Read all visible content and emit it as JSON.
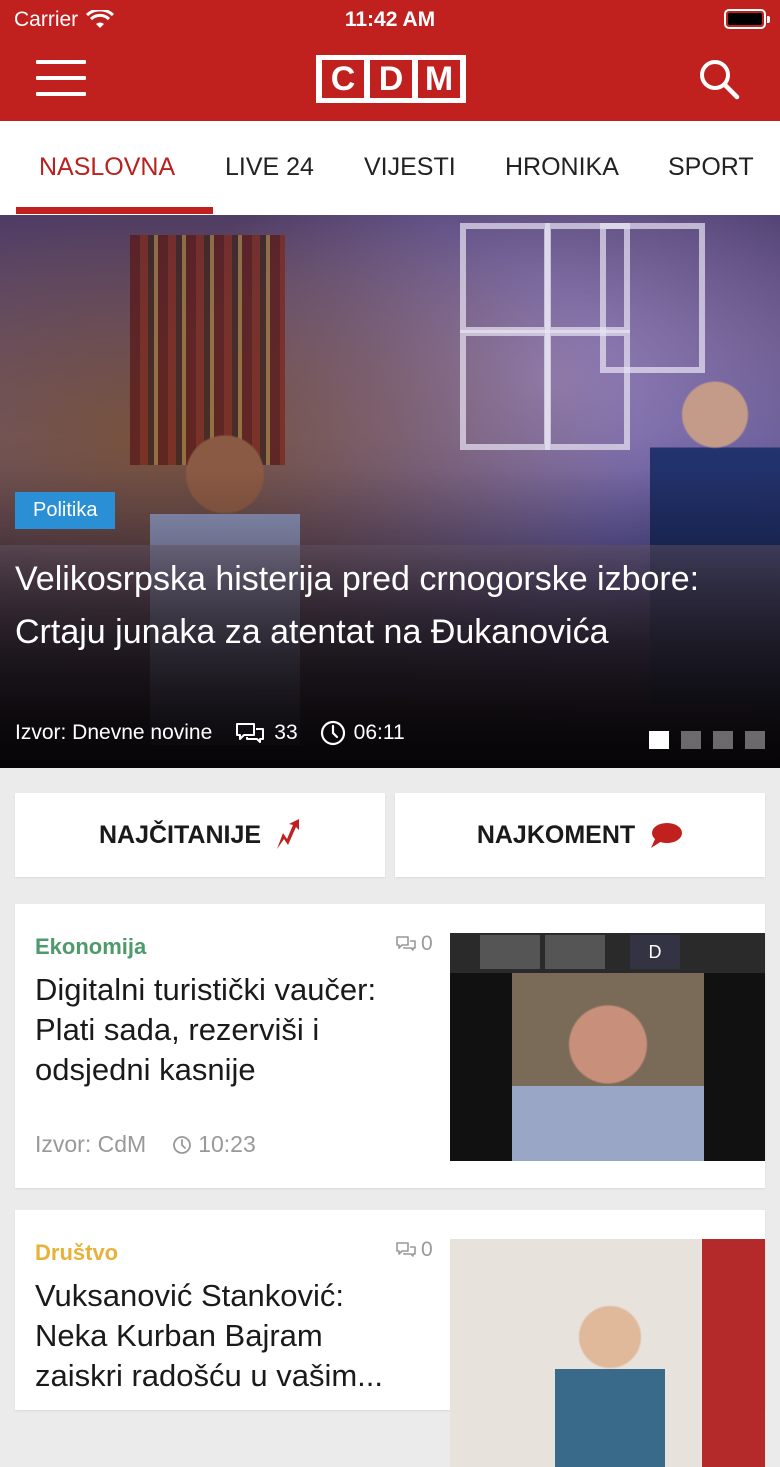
{
  "status": {
    "carrier": "Carrier",
    "time": "11:42 AM"
  },
  "header": {
    "logo": [
      "C",
      "D",
      "M"
    ]
  },
  "tabs": [
    {
      "label": "NASLOVNA",
      "active": true
    },
    {
      "label": "LIVE 24"
    },
    {
      "label": "VIJESTI"
    },
    {
      "label": "HRONIKA"
    },
    {
      "label": "SPORT"
    }
  ],
  "hero": {
    "category": "Politika",
    "title": "Velikosrpska histerija pred crnogorske izbore: Crtaju junaka za atentat na Đukanovića",
    "source": "Izvor: Dnevne novine",
    "comments": "33",
    "time": "06:11",
    "slides": 4,
    "active_slide": 0
  },
  "buttons": {
    "most_read": "NAJČITANIJE",
    "most_commented": "NAJKOMENT"
  },
  "colors": {
    "brand": "#c0211f",
    "hero_badge": "#2a8fd4",
    "ekonomija": "#4e9a6a",
    "drustvo": "#e8b23a"
  },
  "articles": [
    {
      "category": "Ekonomija",
      "category_color": "#4e9a6a",
      "comments": "0",
      "title_lines": [
        "Digitalni turistički vaučer:",
        "Plati sada, rezerviši i",
        "odsjedni kasnije"
      ],
      "source": "Izvor: CdM",
      "time": "10:23",
      "thumb_label": "D"
    },
    {
      "category": "Društvo",
      "category_color": "#e8b23a",
      "comments": "0",
      "title_lines": [
        "Vuksanović Stanković:",
        "Neka Kurban Bajram",
        "zaiskri radošću u vašim..."
      ]
    }
  ]
}
